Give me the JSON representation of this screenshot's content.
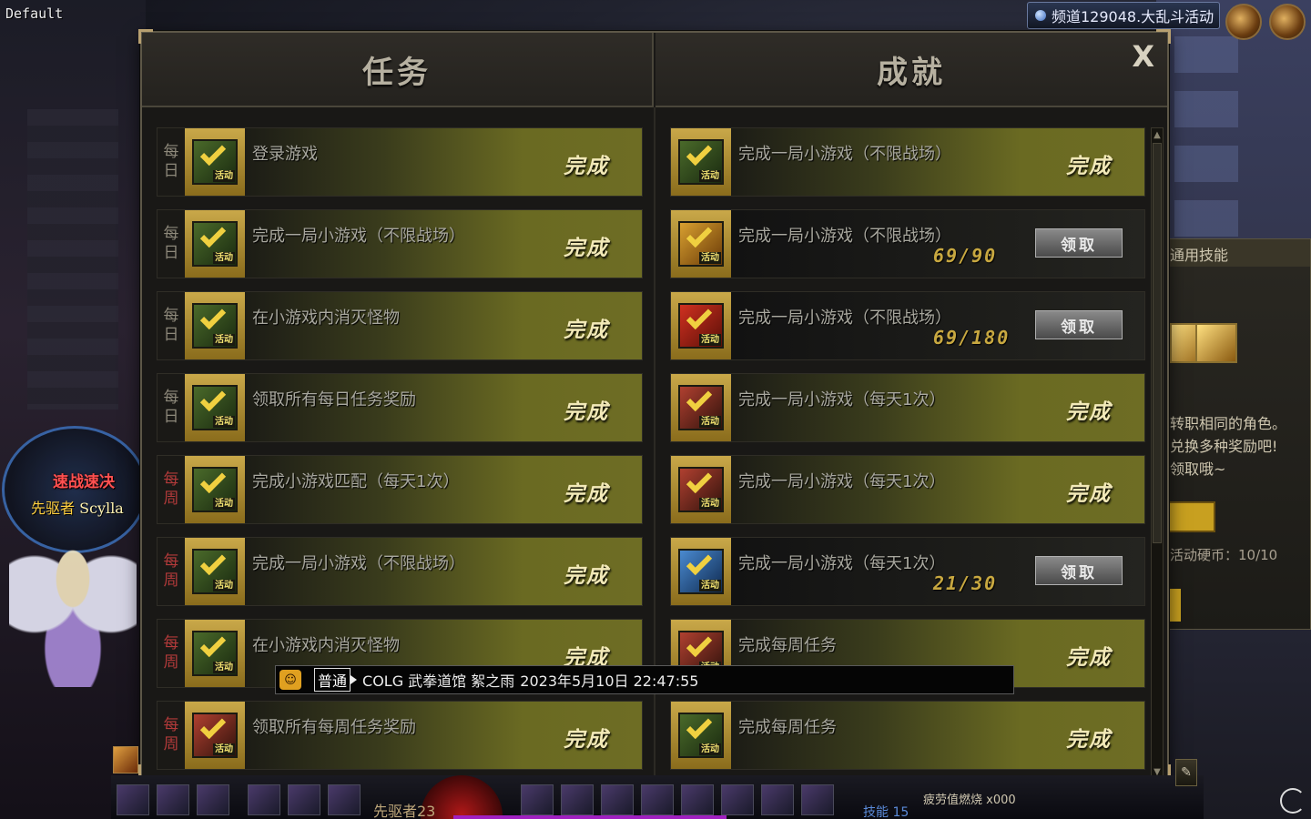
{
  "scene": {
    "profile_label": "Default",
    "channel": "频道129048.大乱斗活动",
    "character": {
      "title": "速战速决",
      "name_prefix": "先驱者",
      "name": "Scylla"
    },
    "side_panel": {
      "header": "通用技能",
      "lines": [
        "转职相同的角色。",
        "兑换多种奖励吧!",
        "领取哦~"
      ],
      "coins": "活动硬币：10/10"
    }
  },
  "window": {
    "tab_quests": "任务",
    "tab_achievements": "成就",
    "close_label": "X",
    "accent_done": "#6a6a22",
    "period_weekly_color": "#b23a3a"
  },
  "quests": [
    {
      "period": [
        "每",
        "日"
      ],
      "weekly": false,
      "title": "登录游戏",
      "status": "完成",
      "icon": "check-gold-icon",
      "tag": "活动"
    },
    {
      "period": [
        "每",
        "日"
      ],
      "weekly": false,
      "title": "完成一局小游戏（不限战场）",
      "status": "完成",
      "icon": "check-gold-icon",
      "tag": "活动"
    },
    {
      "period": [
        "每",
        "日"
      ],
      "weekly": false,
      "title": "在小游戏内消灭怪物",
      "status": "完成",
      "icon": "check-gold-icon",
      "tag": "活动"
    },
    {
      "period": [
        "每",
        "日"
      ],
      "weekly": false,
      "title": "领取所有每日任务奖励",
      "status": "完成",
      "icon": "check-gold-icon",
      "tag": "活动"
    },
    {
      "period": [
        "每",
        "周"
      ],
      "weekly": true,
      "title": "完成小游戏匹配（每天1次）",
      "status": "完成",
      "icon": "check-gold-icon",
      "tag": "活动"
    },
    {
      "period": [
        "每",
        "周"
      ],
      "weekly": true,
      "title": "完成一局小游戏（不限战场）",
      "status": "完成",
      "icon": "check-gold-icon",
      "tag": "活动"
    },
    {
      "period": [
        "每",
        "周"
      ],
      "weekly": true,
      "title": "在小游戏内消灭怪物",
      "status": "完成",
      "icon": "check-gold-icon",
      "tag": "活动"
    },
    {
      "period": [
        "每",
        "周"
      ],
      "weekly": true,
      "title": "领取所有每周任务奖励",
      "status": "完成",
      "icon": "check-red-icon",
      "tag": "活动"
    }
  ],
  "achievements": [
    {
      "title": "完成一局小游戏（不限战场）",
      "state": "done",
      "status": "完成",
      "icon": "check-gold-icon",
      "tag": "活动"
    },
    {
      "title": "完成一局小游戏（不限战场）",
      "state": "open",
      "progress": "69/90",
      "button": "领取",
      "icon": "coin-75-icon",
      "tag": "活动"
    },
    {
      "title": "完成一局小游戏（不限战场）",
      "state": "open",
      "progress": "69/180",
      "button": "领取",
      "icon": "gift-box-icon",
      "tag": "活动"
    },
    {
      "title": "完成一局小游戏（每天1次）",
      "state": "done",
      "status": "完成",
      "icon": "check-red-icon",
      "tag": "活动"
    },
    {
      "title": "完成一局小游戏（每天1次）",
      "state": "done",
      "status": "完成",
      "icon": "check-red-icon",
      "tag": "活动"
    },
    {
      "title": "完成一局小游戏（每天1次）",
      "state": "open",
      "progress": "21/30",
      "button": "领取",
      "icon": "check-blue-icon",
      "tag": "活动"
    },
    {
      "title": "完成每周任务",
      "state": "done",
      "status": "完成",
      "icon": "check-red-icon",
      "tag": "活动"
    },
    {
      "title": "完成每周任务",
      "state": "done",
      "status": "完成",
      "icon": "check-green-icon",
      "tag": "活动"
    }
  ],
  "chat": {
    "channel_badge": "普通",
    "sender": "COLG 武拳道馆 絮之雨",
    "timestamp": "2023年5月10日 22:47:55"
  },
  "hud": {
    "player_name": "先驱者23",
    "skill_label": "技能 15",
    "fatigue_label": "疲劳值燃烧",
    "fatigue_count": "x000"
  }
}
